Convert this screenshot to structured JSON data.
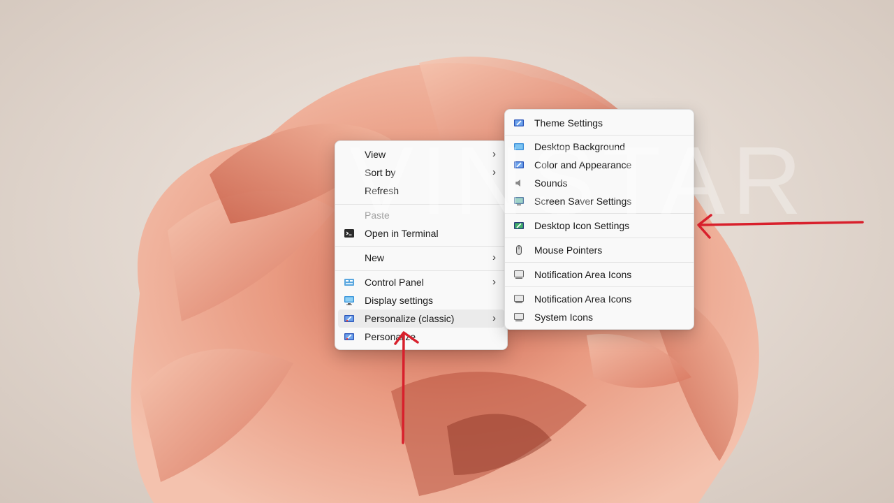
{
  "watermark": "VINSTAR",
  "context_menu": {
    "items": [
      {
        "label": "View",
        "icon": "",
        "submenu": true
      },
      {
        "label": "Sort by",
        "icon": "",
        "submenu": true
      },
      {
        "label": "Refresh",
        "icon": ""
      },
      {
        "label": "Paste",
        "icon": "",
        "disabled": true
      },
      {
        "label": "Open in Terminal",
        "icon": "terminal-icon"
      },
      {
        "label": "New",
        "icon": "",
        "submenu": true
      },
      {
        "label": "Control Panel",
        "icon": "control-panel-icon",
        "submenu": true
      },
      {
        "label": "Display settings",
        "icon": "display-icon"
      },
      {
        "label": "Personalize (classic)",
        "icon": "personalize-icon",
        "submenu": true,
        "highlighted": true
      },
      {
        "label": "Personalize",
        "icon": "personalize-icon"
      }
    ]
  },
  "submenu": {
    "items": [
      {
        "label": "Theme Settings",
        "icon": "theme-icon"
      },
      {
        "label": "Desktop Background",
        "icon": "background-icon"
      },
      {
        "label": "Color and Appearance",
        "icon": "color-icon"
      },
      {
        "label": "Sounds",
        "icon": "speaker-icon"
      },
      {
        "label": "Screen Saver Settings",
        "icon": "screensaver-icon"
      },
      {
        "label": "Desktop Icon Settings",
        "icon": "desktop-icon-settings-icon"
      },
      {
        "label": "Mouse Pointers",
        "icon": "mouse-icon"
      },
      {
        "label": "Notification Area Icons",
        "icon": "notification-area-icon"
      },
      {
        "label": "Notification Area Icons",
        "icon": "notification-area-icon"
      },
      {
        "label": "System Icons",
        "icon": "system-icons-icon"
      }
    ]
  },
  "colors": {
    "menu_bg": "#f9f9f9",
    "arrow": "#d8202c",
    "bloom": "#e9967c"
  }
}
